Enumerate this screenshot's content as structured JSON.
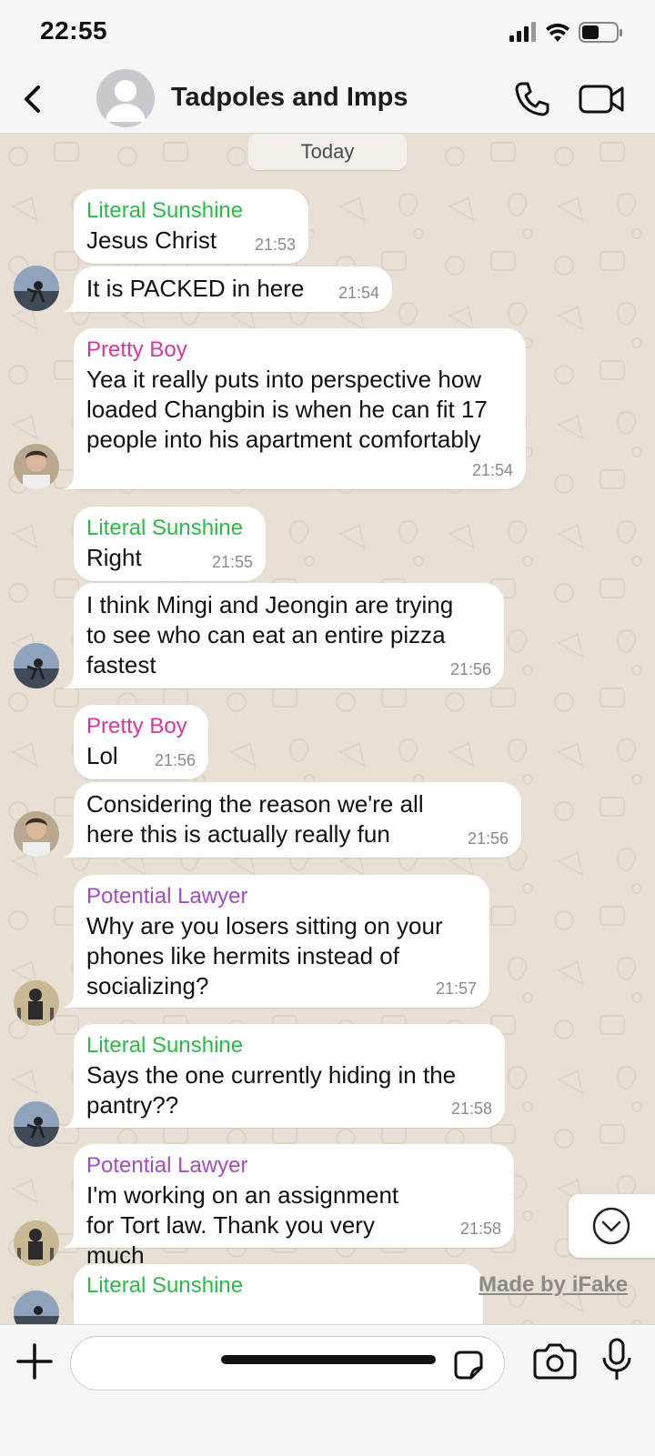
{
  "status_bar": {
    "time": "22:55",
    "icons": [
      "signal-icon",
      "wifi-icon",
      "battery-icon"
    ]
  },
  "header": {
    "title": "Tadpoles and Imps",
    "icons": {
      "back": "chevron-left-icon",
      "avatar": "group-avatar-icon",
      "call": "phone-icon",
      "video": "video-camera-icon"
    }
  },
  "chat": {
    "date_label": "Today",
    "messages": [
      {
        "sender": "Literal Sunshine",
        "text": "Jesus Christ",
        "time": "21:53"
      },
      {
        "sender": "",
        "text": "It is PACKED in here",
        "time": "21:54"
      },
      {
        "sender": "Pretty Boy",
        "text": "Yea it really puts into perspective how loaded Changbin is when he can fit 17 people into his apartment comfortably",
        "time": "21:54"
      },
      {
        "sender": "Literal Sunshine",
        "text": "Right",
        "time": "21:55"
      },
      {
        "sender": "",
        "text": "I think Mingi and Jeongin are trying to see who can eat an entire pizza fastest",
        "time": "21:56"
      },
      {
        "sender": "Pretty Boy",
        "text": "Lol",
        "time": "21:56"
      },
      {
        "sender": "",
        "text": "Considering the reason we're all here this is actually really fun",
        "time": "21:56"
      },
      {
        "sender": "Potential Lawyer",
        "text": "Why are you losers sitting on your phones like hermits instead of socializing?",
        "time": "21:57"
      },
      {
        "sender": "Literal Sunshine",
        "text": "Says the one currently hiding in the pantry??",
        "time": "21:58"
      },
      {
        "sender": "Potential Lawyer",
        "text": "I'm working on an assignment for Tort law. Thank you very much",
        "time": "21:58"
      },
      {
        "sender": "Literal Sunshine",
        "text": "",
        "time": ""
      }
    ]
  },
  "colors": {
    "Literal Sunshine": "#2fb84a",
    "Pretty Boy": "#d6379a",
    "Potential Lawyer": "#a24cc2",
    "background": "#e8e0d5"
  },
  "watermark": "Made by iFake",
  "input_bar": {
    "placeholder": "",
    "icons": [
      "plus-icon",
      "sticker-icon",
      "camera-icon",
      "microphone-icon"
    ]
  }
}
